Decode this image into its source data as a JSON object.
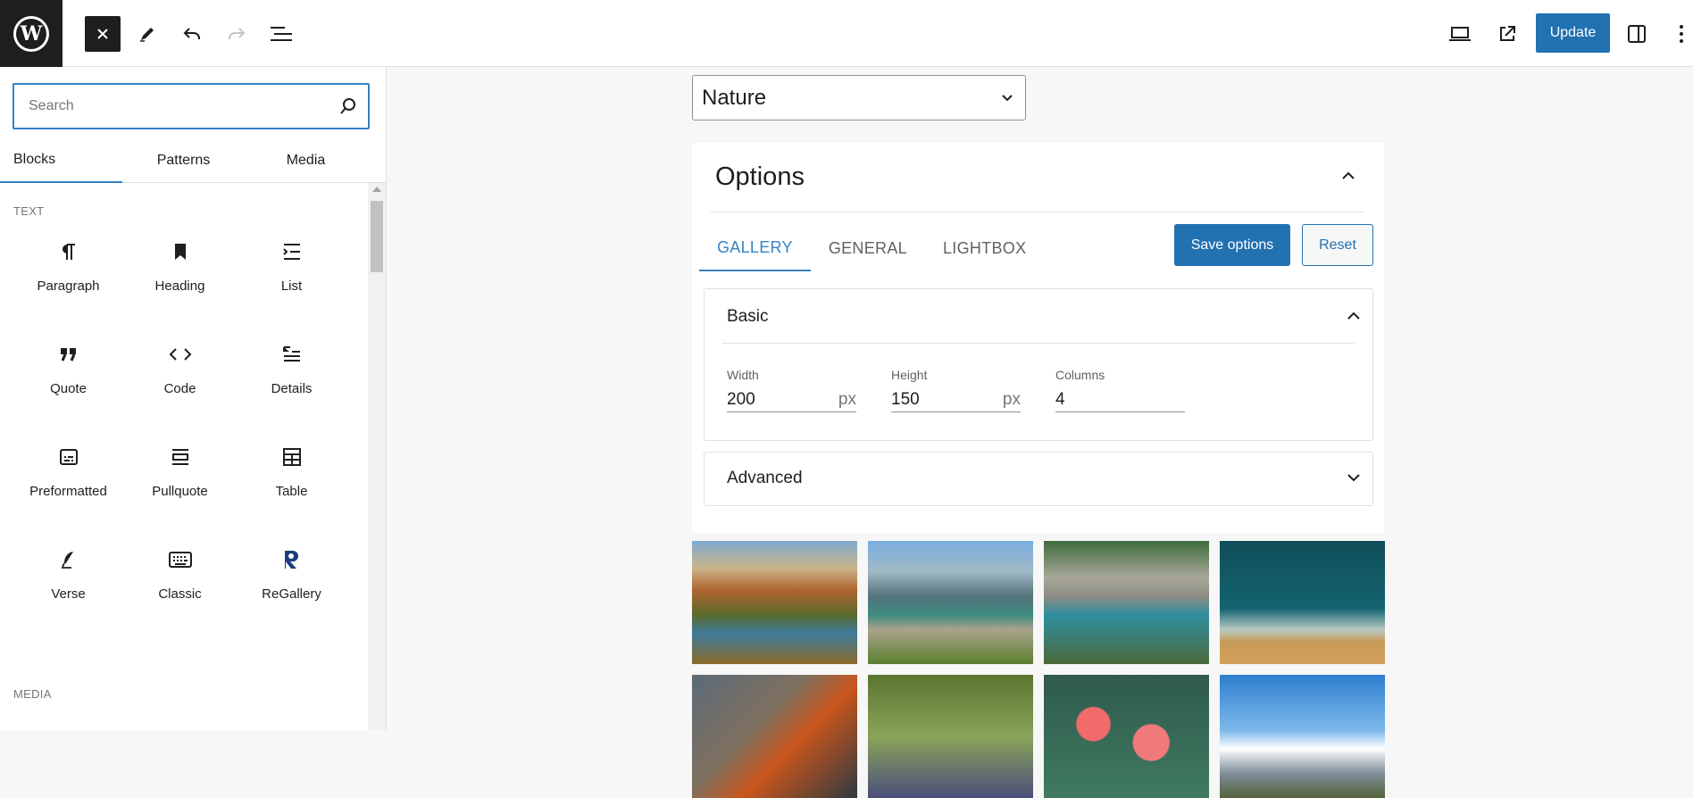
{
  "toolbar": {
    "logo_letter": "W",
    "update_label": "Update",
    "icons": [
      "wordpress-logo",
      "close-icon",
      "pencil-icon",
      "undo-icon",
      "redo-icon",
      "list-view-icon",
      "desktop-preview-icon",
      "external-link-icon",
      "sidebar-toggle-icon",
      "more-options-icon"
    ]
  },
  "inserter": {
    "search_placeholder": "Search",
    "search_value": "",
    "tabs": [
      {
        "label": "Blocks",
        "active": true
      },
      {
        "label": "Patterns",
        "active": false
      },
      {
        "label": "Media",
        "active": false
      }
    ],
    "sections": {
      "text": "TEXT",
      "media": "MEDIA"
    },
    "blocks": [
      {
        "label": "Paragraph",
        "icon": "paragraph-icon"
      },
      {
        "label": "Heading",
        "icon": "bookmark-icon"
      },
      {
        "label": "List",
        "icon": "list-icon"
      },
      {
        "label": "Quote",
        "icon": "quote-icon"
      },
      {
        "label": "Code",
        "icon": "code-icon"
      },
      {
        "label": "Details",
        "icon": "details-icon"
      },
      {
        "label": "Preformatted",
        "icon": "preformatted-icon"
      },
      {
        "label": "Pullquote",
        "icon": "pullquote-icon"
      },
      {
        "label": "Table",
        "icon": "table-icon"
      },
      {
        "label": "Verse",
        "icon": "feather-icon"
      },
      {
        "label": "Classic",
        "icon": "keyboard-icon"
      },
      {
        "label": "ReGallery",
        "icon": "regallery-icon"
      }
    ]
  },
  "canvas": {
    "gallery_select": {
      "value": "Nature"
    },
    "options": {
      "title": "Options",
      "tabs": [
        {
          "label": "GALLERY",
          "active": true
        },
        {
          "label": "GENERAL",
          "active": false
        },
        {
          "label": "LIGHTBOX",
          "active": false
        }
      ],
      "save_label": "Save options",
      "reset_label": "Reset",
      "basic": {
        "title": "Basic",
        "width": {
          "label": "Width",
          "value": "200",
          "unit": "px"
        },
        "height": {
          "label": "Height",
          "value": "150",
          "unit": "px"
        },
        "columns": {
          "label": "Columns",
          "value": "4"
        }
      },
      "advanced": {
        "title": "Advanced"
      }
    },
    "thumbnails_count": 8
  },
  "colors": {
    "accent": "#2271b1",
    "accent_light": "#3582c4",
    "dark": "#1e1e1e"
  }
}
